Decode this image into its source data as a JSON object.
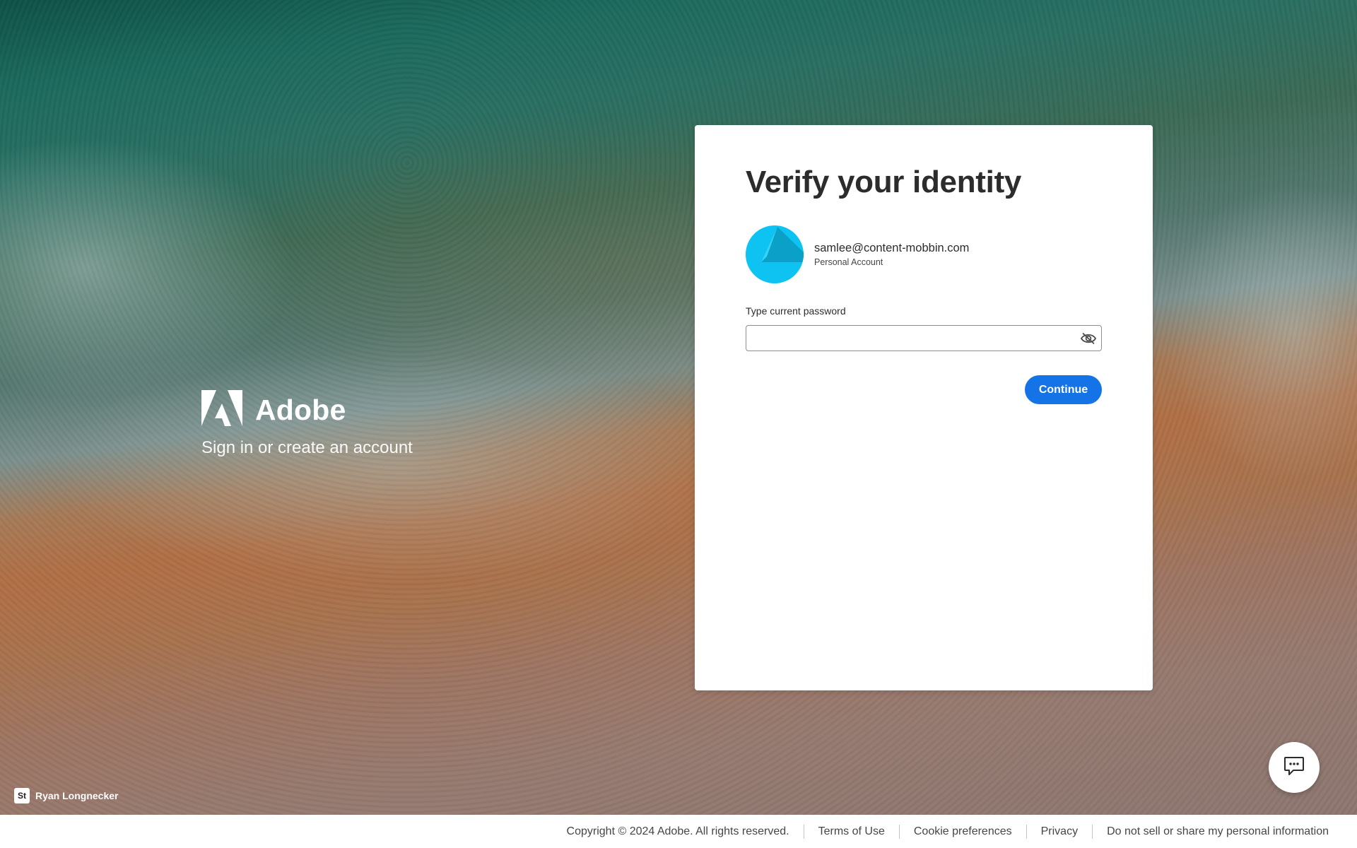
{
  "brand": {
    "name": "Adobe",
    "tagline": "Sign in or create an account"
  },
  "card": {
    "title": "Verify your identity",
    "account": {
      "email": "samlee@content-mobbin.com",
      "type": "Personal Account",
      "avatar_color": "#0ec3f2"
    },
    "password": {
      "label": "Type current password",
      "value": "",
      "placeholder": ""
    },
    "continue_label": "Continue"
  },
  "photo_credit": {
    "badge": "St",
    "name": "Ryan Longnecker"
  },
  "footer": {
    "copyright": "Copyright © 2024 Adobe. All rights reserved.",
    "links": {
      "terms": "Terms of Use",
      "cookies": "Cookie preferences",
      "privacy": "Privacy",
      "do_not_sell": "Do not sell or share my personal information"
    }
  },
  "colors": {
    "primary_button": "#1473e6",
    "title_text": "#2c2c2c"
  }
}
